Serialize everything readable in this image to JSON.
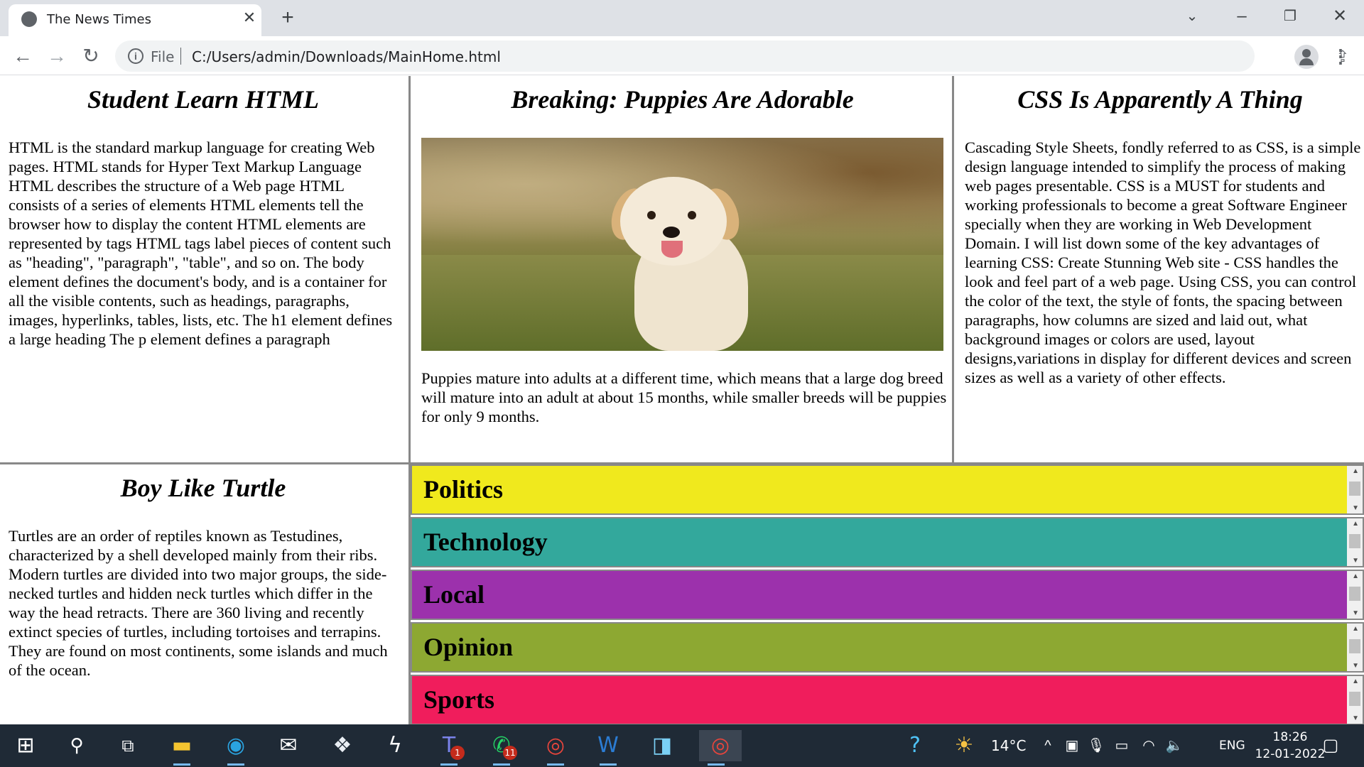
{
  "browser": {
    "tab_title": "The News Times",
    "file_label": "File",
    "url": "C:/Users/admin/Downloads/MainHome.html"
  },
  "articles": {
    "html": {
      "title": "Student Learn HTML",
      "body": "HTML is the standard markup language for creating Web pages. HTML stands for Hyper Text Markup Language HTML describes the structure of a Web page HTML consists of a series of elements HTML elements tell the browser how to display the content HTML elements are represented by tags HTML tags label pieces of content such as \"heading\", \"paragraph\", \"table\", and so on. The body element defines the document's body, and is a container for all the visible contents, such as headings, paragraphs, images, hyperlinks, tables, lists, etc. The h1 element defines a large heading The p element defines a paragraph"
    },
    "puppies": {
      "title": "Breaking: Puppies Are Adorable",
      "body": "Puppies mature into adults at a different time, which means that a large dog breed will mature into an adult at about 15 months, while smaller breeds will be puppies for only 9 months."
    },
    "css": {
      "title": "CSS Is Apparently A Thing",
      "body": "Cascading Style Sheets, fondly referred to as CSS, is a simple design language intended to simplify the process of making web pages presentable. CSS is a MUST for students and working professionals to become a great Software Engineer specially when they are working in Web Development Domain. I will list down some of the key advantages of learning CSS: Create Stunning Web site - CSS handles the look and feel part of a web page. Using CSS, you can control the color of the text, the style of fonts, the spacing between paragraphs, how columns are sized and laid out, what background images or colors are used, layout designs,variations in display for different devices and screen sizes as well as a variety of other effects."
    },
    "turtle": {
      "title": "Boy Like Turtle",
      "body": "Turtles are an order of reptiles known as Testudines, characterized by a shell developed mainly from their ribs. Modern turtles are divided into two major groups, the side-necked turtles and hidden neck turtles which differ in the way the head retracts. There are 360 living and recently extinct species of turtles, including tortoises and terrapins. They are found on most continents, some islands and much of the ocean."
    }
  },
  "sections": [
    {
      "label": "Politics",
      "color": "#f0e91d"
    },
    {
      "label": "Technology",
      "color": "#33a89c"
    },
    {
      "label": "Local",
      "color": "#9c31ac"
    },
    {
      "label": "Opinion",
      "color": "#8da832"
    },
    {
      "label": "Sports",
      "color": "#f01d5c"
    }
  ],
  "taskbar": {
    "teams_badge": "1",
    "whatsapp_badge": "11",
    "temperature": "14°C",
    "language": "ENG",
    "time": "18:26",
    "date": "12-01-2022"
  }
}
